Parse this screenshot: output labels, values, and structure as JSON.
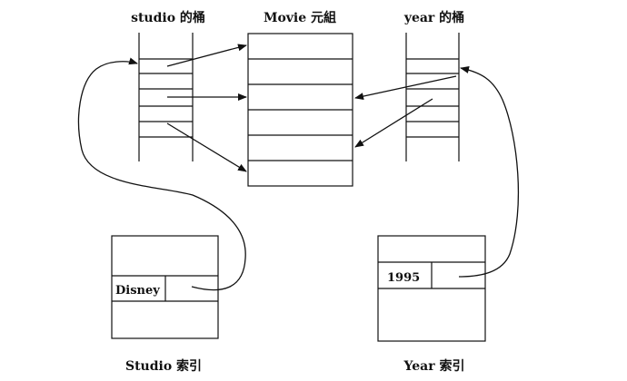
{
  "labels": {
    "studio_buckets": "studio 的桶",
    "movie_tuples": "Movie 元組",
    "year_buckets": "year 的桶",
    "studio_index": "Studio 索引",
    "year_index": "Year 索引"
  },
  "index_cells": {
    "studio_key": "Disney",
    "year_key": "1995"
  }
}
